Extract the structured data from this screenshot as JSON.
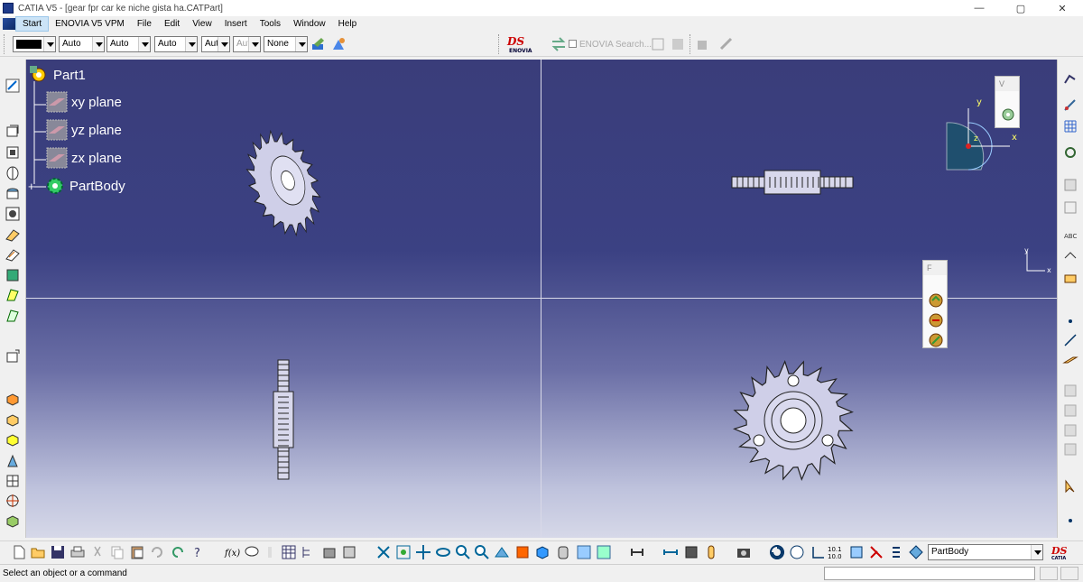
{
  "window": {
    "title": "CATIA V5 - [gear fpr car ke niche gista ha.CATPart]",
    "minimize": "—",
    "maximize": "▢",
    "close": "✕"
  },
  "menu": {
    "items": [
      "Start",
      "ENOVIA V5 VPM",
      "File",
      "Edit",
      "View",
      "Insert",
      "Tools",
      "Window",
      "Help"
    ]
  },
  "toolbar": {
    "color_value": "",
    "transparency": "Auto",
    "linetype": "Auto",
    "thickness": "Auto",
    "point": "Aut",
    "point2": "Aut",
    "layer": "None",
    "enovia_label": "ENOVIA",
    "enovia_search": "ENOVIA Search..."
  },
  "tree": {
    "root": "Part1",
    "children": [
      "xy plane",
      "yz plane",
      "zx plane",
      "PartBody"
    ]
  },
  "compass": {
    "x": "x",
    "y": "y",
    "z": "z"
  },
  "floating": {
    "view_panel_title": "V",
    "feature_panel_title": "F"
  },
  "bottom_toolbar": {
    "current_body": "PartBody",
    "measure_label": "10.1\n10.0"
  },
  "status": {
    "message": "Select an object or a command",
    "command_value": ""
  },
  "colors": {
    "viewport_top": "#3a3d7a",
    "viewport_bottom": "#d6d8e8",
    "gear_fill": "#c9c9e6"
  }
}
